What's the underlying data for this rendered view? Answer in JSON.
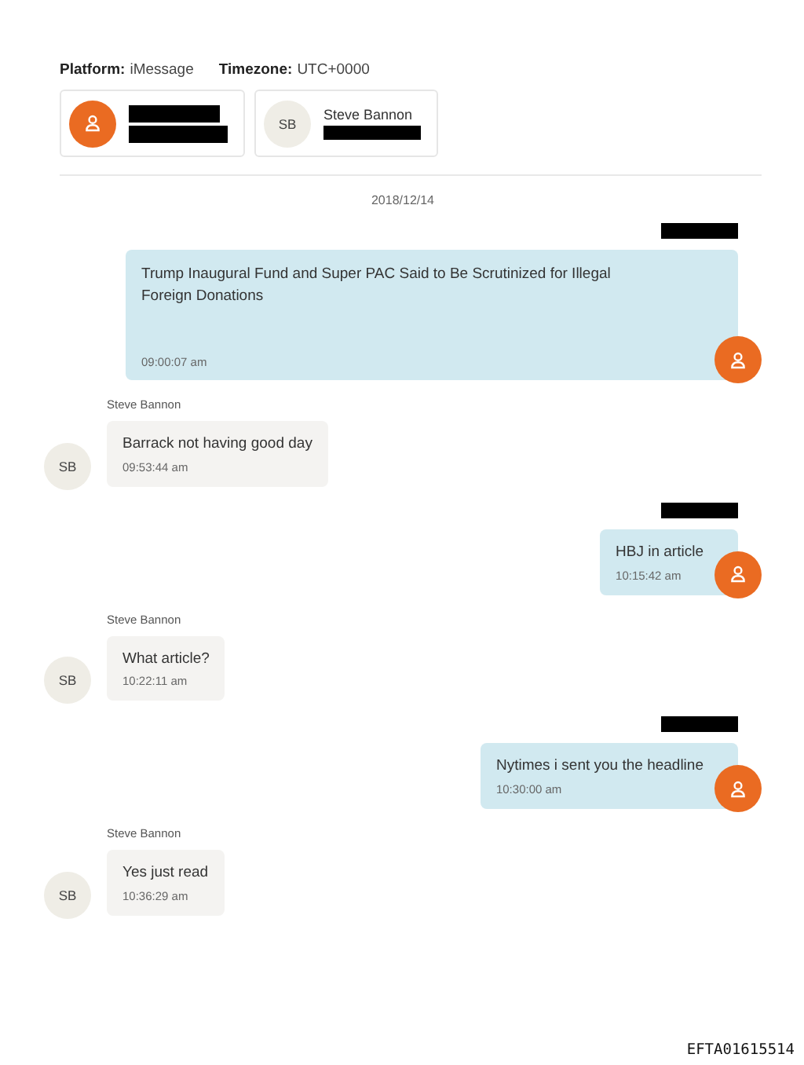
{
  "header": {
    "platform_label": "Platform:",
    "platform": "iMessage",
    "timezone_label": "Timezone:",
    "timezone": "UTC+0000"
  },
  "participants": [
    {
      "kind": "user",
      "name_redacted": true,
      "handle_redacted": true
    },
    {
      "kind": "initials",
      "initials": "SB",
      "name": "Steve Bannon",
      "handle_redacted": true
    }
  ],
  "date": "2018/12/14",
  "messages": [
    {
      "kind": "outgoing",
      "sender_redacted": true,
      "text": "Trump Inaugural Fund and Super PAC Said to Be Scrutinized for Illegal Foreign Donations",
      "time": "09:00:07 am"
    },
    {
      "kind": "incoming",
      "sender": "Steve Bannon",
      "avatar": "SB",
      "text": "Barrack not having good day",
      "time": "09:53:44 am"
    },
    {
      "kind": "outgoing",
      "sender_redacted": true,
      "text": "HBJ in article",
      "time": "10:15:42 am"
    },
    {
      "kind": "incoming",
      "sender": "Steve Bannon",
      "avatar": "SB",
      "text": "What article?",
      "time": "10:22:11 am"
    },
    {
      "kind": "outgoing",
      "sender_redacted": true,
      "text": "Nytimes i sent you the headline",
      "time": "10:30:00 am"
    },
    {
      "kind": "incoming",
      "sender": "Steve Bannon",
      "avatar": "SB",
      "text": "Yes just read",
      "time": "10:36:29 am"
    }
  ],
  "footer": "EFTA01615514"
}
